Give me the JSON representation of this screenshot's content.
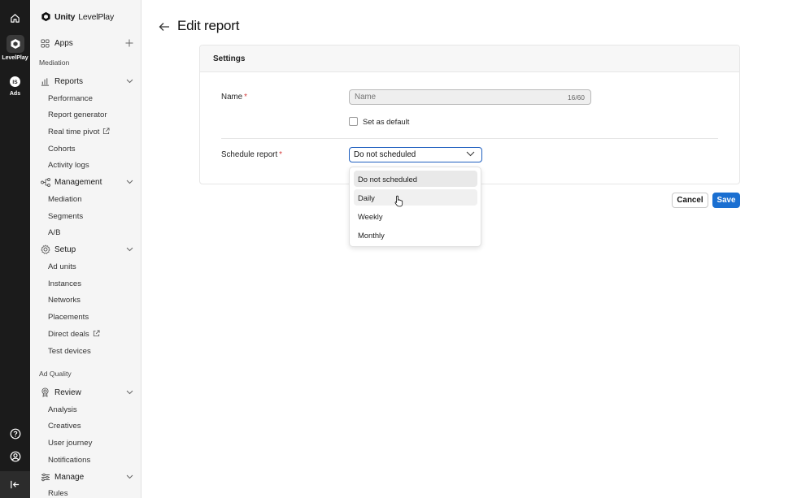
{
  "rail": {
    "levelplay_label": "LevelPlay",
    "ads_label": "Ads"
  },
  "brand": {
    "bold": "Unity",
    "light": "LevelPlay"
  },
  "sidebar": {
    "apps_label": "Apps",
    "mediation_heading": "Mediation",
    "reports": {
      "label": "Reports",
      "items": [
        "Performance",
        "Report generator",
        "Real time pivot",
        "Cohorts",
        "Activity logs"
      ]
    },
    "management": {
      "label": "Management",
      "items": [
        "Mediation",
        "Segments",
        "A/B"
      ]
    },
    "setup": {
      "label": "Setup",
      "items": [
        "Ad units",
        "Instances",
        "Networks",
        "Placements",
        "Direct deals",
        "Test devices"
      ]
    },
    "ad_quality_heading": "Ad Quality",
    "review": {
      "label": "Review",
      "items": [
        "Analysis",
        "Creatives",
        "User journey",
        "Notifications"
      ]
    },
    "manage": {
      "label": "Manage",
      "items": [
        "Rules"
      ]
    }
  },
  "page": {
    "title": "Edit report",
    "card_title": "Settings",
    "name_label": "Name",
    "name_placeholder": "Name",
    "name_counter": "16/60",
    "set_default_label": "Set as default",
    "schedule_label": "Schedule report",
    "schedule_value": "Do not scheduled",
    "schedule_options": [
      "Do not scheduled",
      "Daily",
      "Weekly",
      "Monthly"
    ],
    "cancel_label": "Cancel",
    "save_label": "Save"
  },
  "colors": {
    "accent": "#1a6fd1",
    "focus": "#1f5fbf",
    "required": "#d43b3b",
    "rail": "#1b1b1b"
  }
}
